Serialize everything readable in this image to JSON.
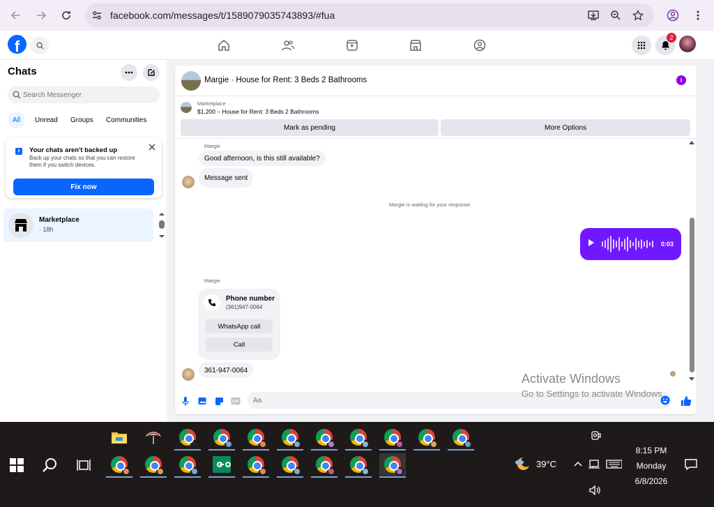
{
  "browser": {
    "url": "facebook.com/messages/t/1589079035743893/#fua",
    "icons": [
      "back-icon",
      "forward-icon",
      "reload-icon",
      "site-settings-icon",
      "install-icon",
      "zoom-icon",
      "star-icon",
      "profile-icon",
      "menu-icon"
    ]
  },
  "fb_top": {
    "logo_letter": "f",
    "notification_count": "2"
  },
  "left_panel": {
    "title": "Chats",
    "search_placeholder": "Search Messenger",
    "filters": [
      "All",
      "Unread",
      "Groups",
      "Communities"
    ],
    "active_filter": "All",
    "backup": {
      "title": "Your chats aren't backed up",
      "description": "Back up your chats so that you can restore them if you switch devices.",
      "button": "Fix now"
    },
    "conversations": [
      {
        "name": "Marketplace",
        "time": "· 18h"
      }
    ]
  },
  "chat": {
    "header_title": "Margie · House for Rent: 3 Beds 2 Bathrooms",
    "marketplace_label": "Marketplace",
    "listing": "$1,200 – House for Rent: 3 Beds 2 Bathrooms",
    "buttons": [
      "Mark as pending",
      "More Options"
    ],
    "messages": {
      "sender": "Margie",
      "msg1": "Good afternoon, is this still available?",
      "msg2": "Message sent",
      "waiting": "Margie is waiting for your response.",
      "voice_duration": "0:03",
      "phone_title": "Phone number",
      "phone_number": "(361)947-0064",
      "whatsapp_button": "WhatsApp call",
      "call_button": "Call",
      "msg3": "361-947-0064"
    },
    "composer_placeholder": "Aa"
  },
  "watermark": {
    "line1": "Activate Windows",
    "line2": "Go to Settings to activate Windows."
  },
  "taskbar": {
    "temperature": "39°C",
    "time": "8:15 PM",
    "day": "Monday",
    "date": "6/8/2026"
  },
  "colors": {
    "fb_blue": "#0866ff",
    "voice_purple": "#7018ff",
    "info_purple": "#9000e6",
    "badge_red": "#e41e3f"
  }
}
